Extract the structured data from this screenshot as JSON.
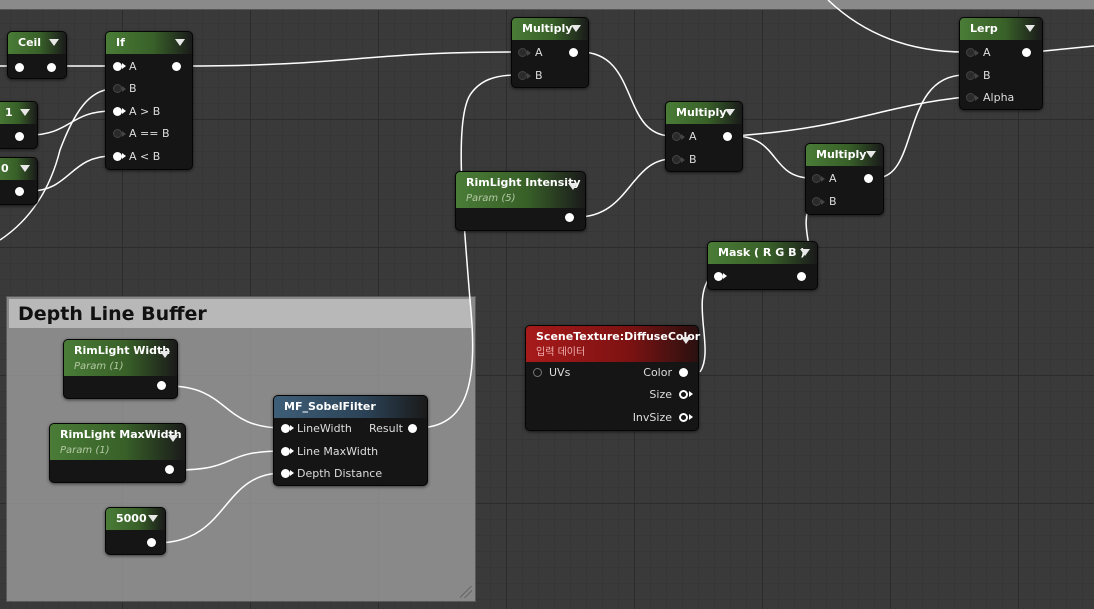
{
  "comment": {
    "title": "Depth Line Buffer"
  },
  "nodes": {
    "ceil": {
      "title": "Ceil"
    },
    "const1": {
      "title": "1"
    },
    "const0": {
      "title": "0"
    },
    "if": {
      "title": "If",
      "pins": [
        "A",
        "B",
        "A > B",
        "A == B",
        "A < B"
      ]
    },
    "multiply1": {
      "title": "Multiply",
      "pins": [
        "A",
        "B"
      ]
    },
    "multiply2": {
      "title": "Multiply",
      "pins": [
        "A",
        "B"
      ]
    },
    "multiply3": {
      "title": "Multiply",
      "pins": [
        "A",
        "B"
      ]
    },
    "lerp": {
      "title": "Lerp",
      "pins": [
        "A",
        "B",
        "Alpha"
      ]
    },
    "rim_intensity": {
      "title": "RimLight Intensity",
      "subtitle": "Param (5)"
    },
    "mask": {
      "title": "Mask ( R G B )"
    },
    "scene_texture": {
      "title": "SceneTexture:DiffuseColor",
      "subtitle": "입력 데이터",
      "input": "UVs",
      "outputs": [
        "Color",
        "Size",
        "InvSize"
      ]
    },
    "rim_width": {
      "title": "RimLight Width",
      "subtitle": "Param (1)"
    },
    "rim_maxwidth": {
      "title": "RimLight MaxWidth",
      "subtitle": "Param (1)"
    },
    "const5000": {
      "title": "5000"
    },
    "sobel": {
      "title": "MF_SobelFilter",
      "inputs": [
        "LineWidth",
        "Line MaxWidth",
        "Depth Distance"
      ],
      "output": "Result"
    }
  },
  "colors": {
    "header_green": "#4a7c37",
    "header_blue": "#3e5e78",
    "header_red": "#a71a1a",
    "wire": "#ffffff",
    "grid": "#3a3a3a"
  }
}
